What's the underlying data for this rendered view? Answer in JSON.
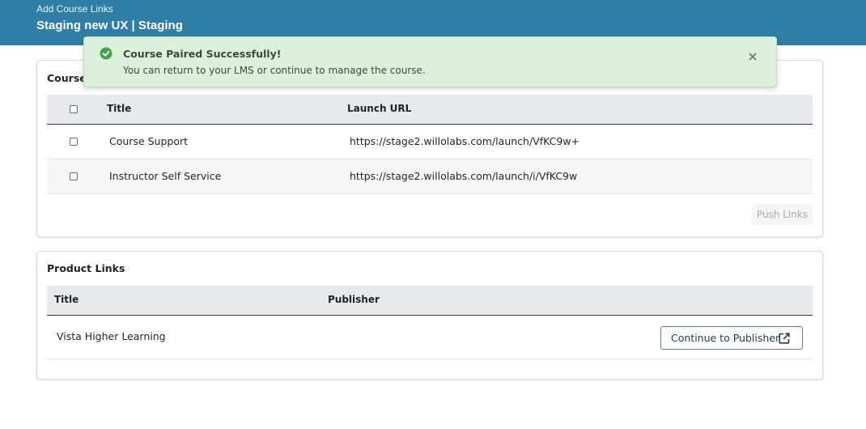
{
  "header": {
    "subtitle": "Add Course Links",
    "title": "Staging new UX | Staging"
  },
  "toast": {
    "title": "Course Paired Successfully!",
    "message": "You can return to your LMS or continue to manage the course."
  },
  "course_links": {
    "title": "Course",
    "columns": [
      "Title",
      "Launch URL"
    ],
    "rows": [
      {
        "title": "Course Support",
        "url": "https://stage2.willolabs.com/launch/VfKC9w+"
      },
      {
        "title": "Instructor Self Service",
        "url": "https://stage2.willolabs.com/launch/i/VfKC9w"
      }
    ],
    "push_button": "Push Links"
  },
  "product_links": {
    "title": "Product Links",
    "columns": [
      "Title",
      "Publisher"
    ],
    "rows": [
      {
        "title": "Vista Higher Learning",
        "action": "Continue to Publisher"
      }
    ]
  },
  "colors": {
    "header": "#2e7ea6",
    "toast_bg": "#dcf0dc",
    "success_icon": "#3fa34d"
  }
}
